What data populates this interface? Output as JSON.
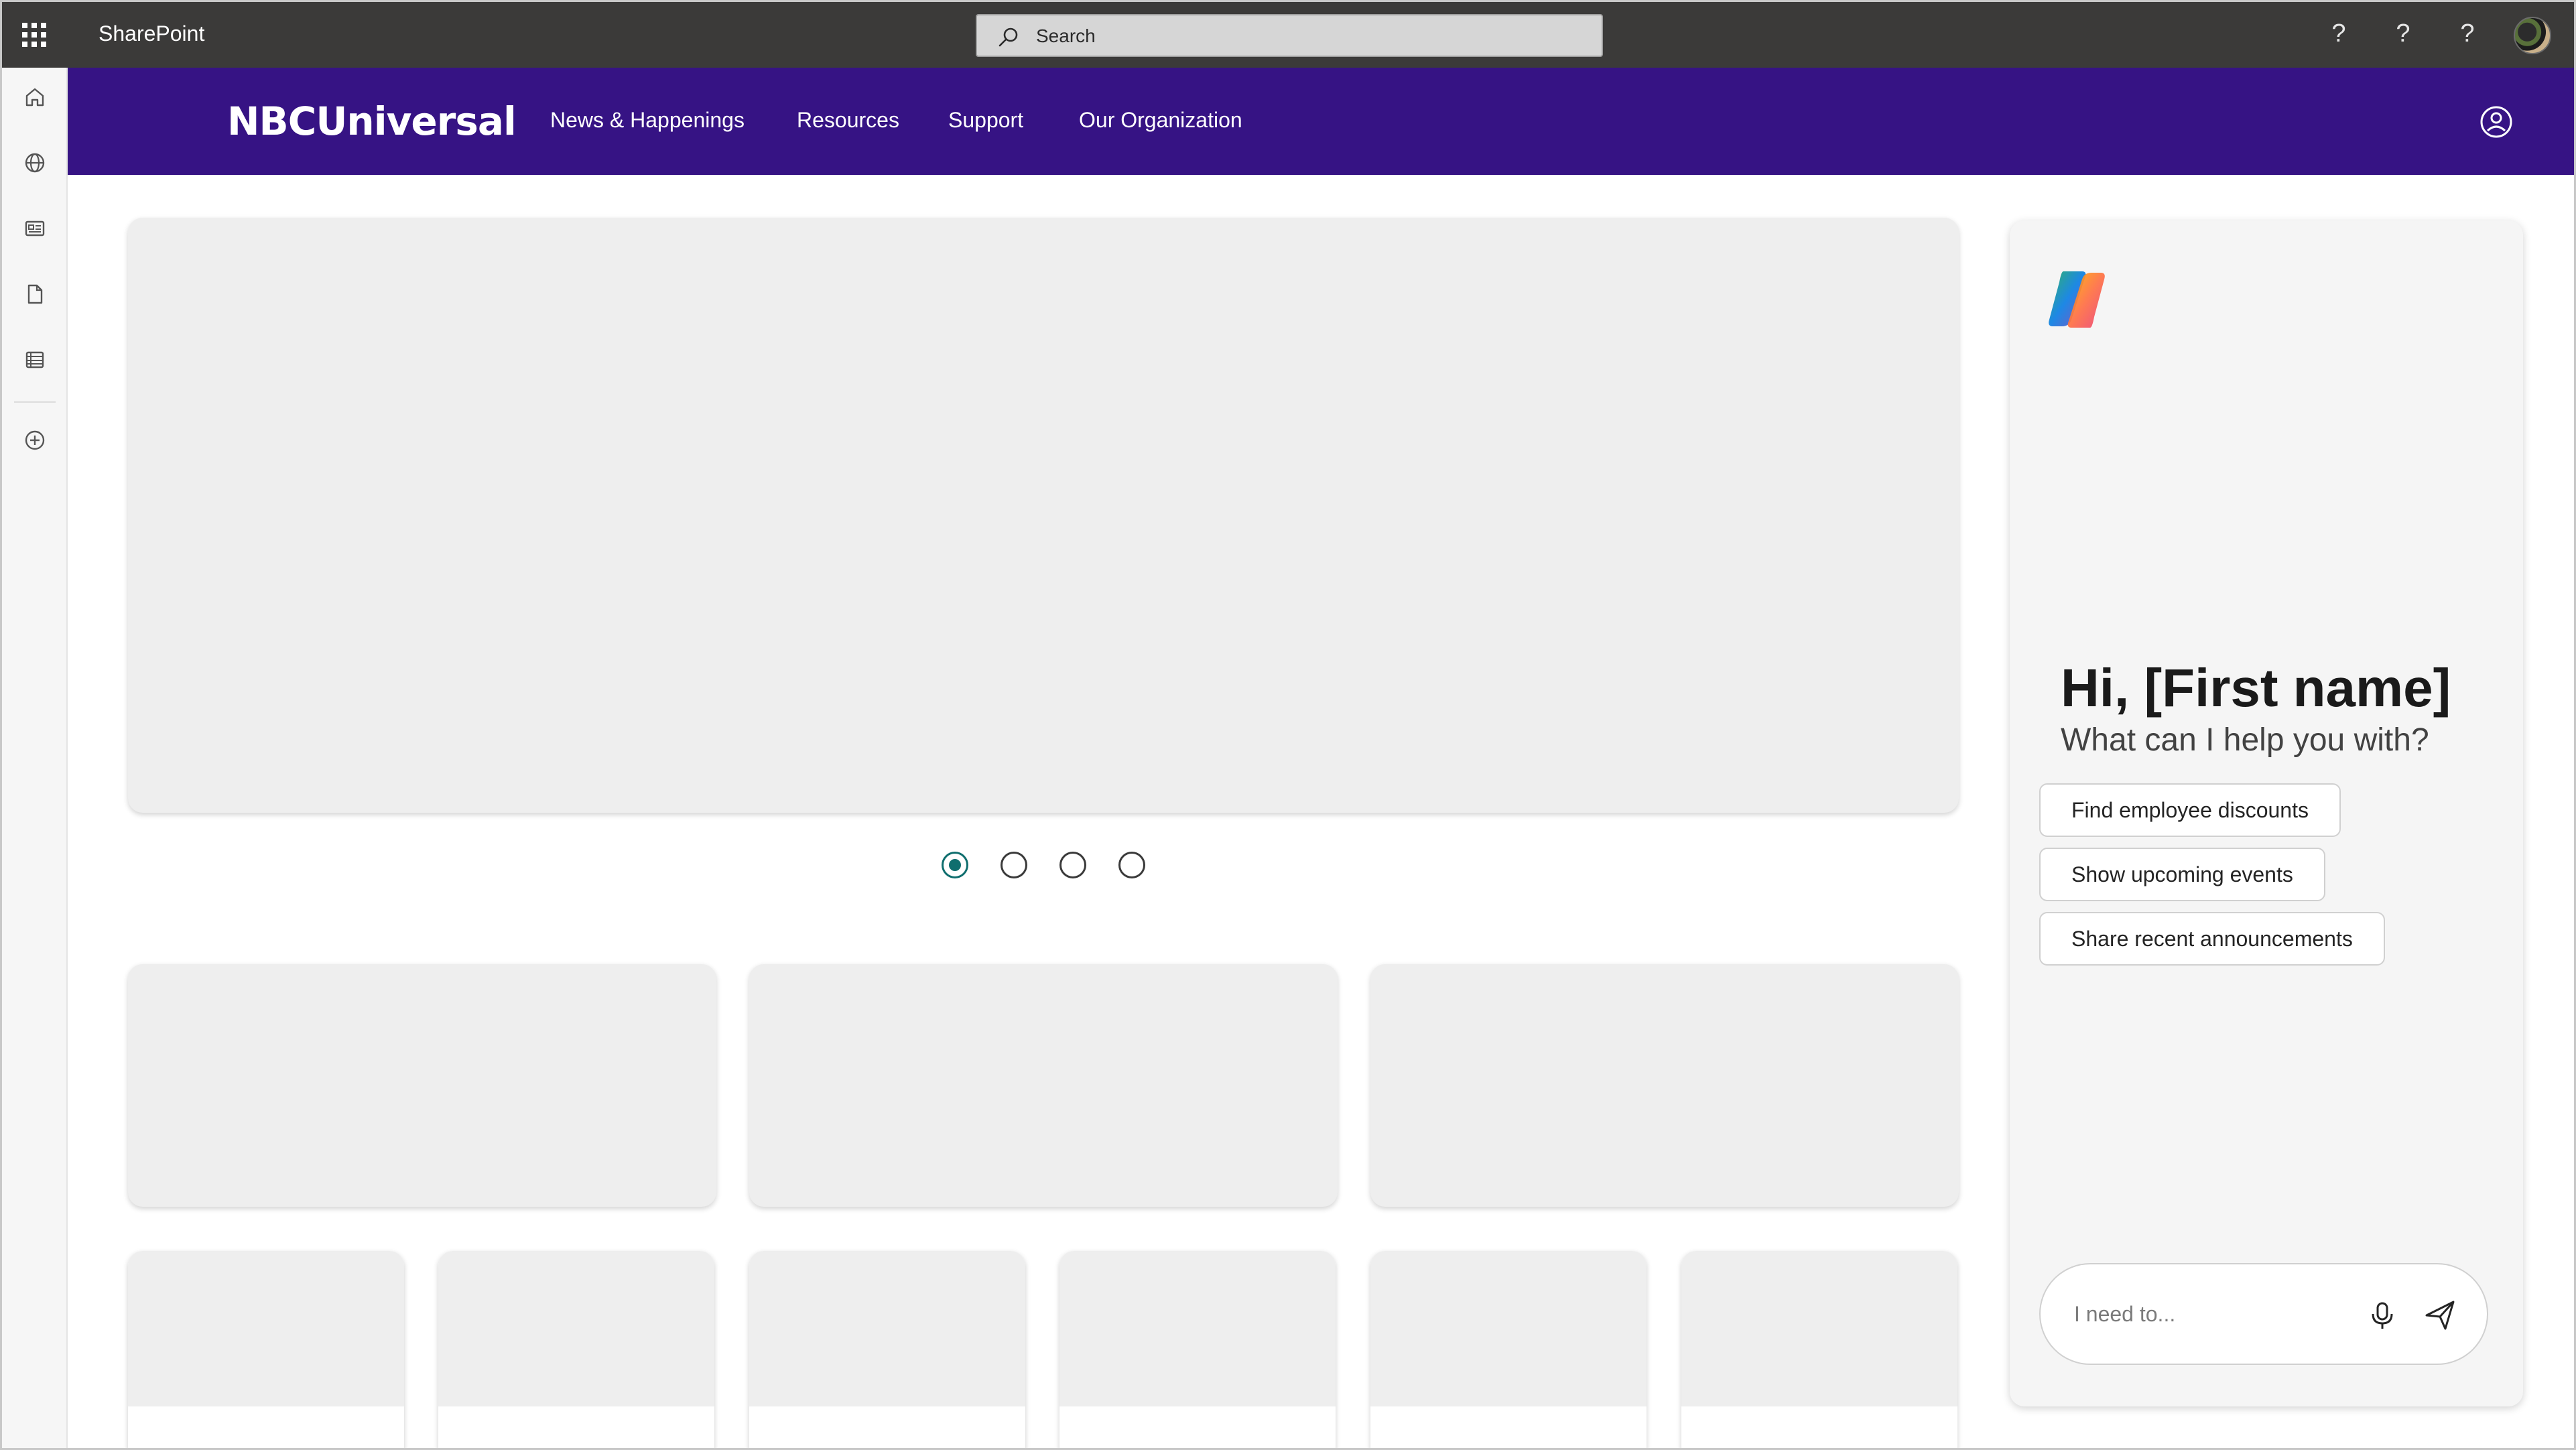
{
  "suite_bar": {
    "app_name": "SharePoint",
    "search_placeholder": "Search",
    "help_icons": [
      "?",
      "?",
      "?"
    ],
    "icons": [
      "waffle-icon",
      "search-icon",
      "help-icon",
      "avatar"
    ]
  },
  "left_rail": {
    "icons": [
      "home-icon",
      "globe-icon",
      "news-icon",
      "document-icon",
      "list-icon",
      "add-circle-icon"
    ]
  },
  "hub_nav": {
    "brand": "NBCUniversal",
    "links": [
      "News & Happenings",
      "Resources",
      "Support",
      "Our Organization"
    ],
    "profile_icon": "person-circle-icon",
    "background": "#361384"
  },
  "carousel": {
    "dot_count": 4,
    "active_index": 0,
    "active_color": "#0f6e6e"
  },
  "copilot": {
    "greeting": "Hi, [First name]",
    "subgreeting": "What can I help you with?",
    "suggestions": [
      "Find employee discounts",
      "Show upcoming events",
      "Share recent announcements"
    ],
    "input_placeholder": "I need to...",
    "icons": [
      "copilot-logo-icon",
      "microphone-icon",
      "send-icon"
    ]
  }
}
